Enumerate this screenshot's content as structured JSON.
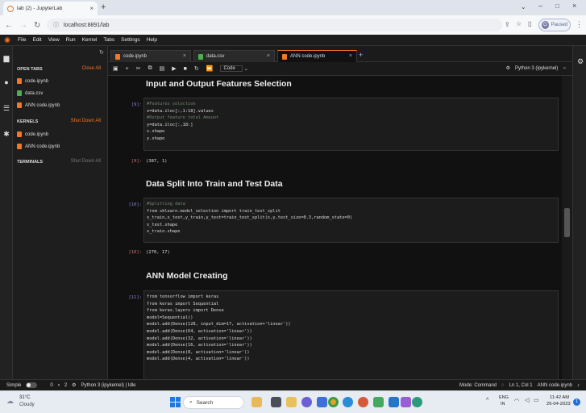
{
  "browser": {
    "tab_title": "lab (2) - JupyterLab",
    "url": "localhost:8891/lab",
    "profile_initial": "G",
    "profile_status": "Paused"
  },
  "menu": [
    "File",
    "Edit",
    "View",
    "Run",
    "Kernel",
    "Tabs",
    "Settings",
    "Help"
  ],
  "sidebar": {
    "open_tabs_title": "OPEN TABS",
    "close_all": "Close All",
    "open_tabs": [
      "code.ipynb",
      "data.csv",
      "ANN code.ipynb"
    ],
    "kernels_title": "KERNELS",
    "shut_down_all": "Shut Down All",
    "kernels": [
      "code.ipynb",
      "ANN code.ipynb"
    ],
    "terminals_title": "TERMINALS",
    "terminals_shut": "Shut Down All"
  },
  "notebook_tabs": [
    {
      "label": "code.ipynb",
      "active": false
    },
    {
      "label": "data.csv",
      "active": false
    },
    {
      "label": "ANN code.ipynb",
      "active": true
    }
  ],
  "toolbar": {
    "cell_type": "Code",
    "kernel": "Python 3 (ipykernel)"
  },
  "cells": {
    "h1": "Input and Output Features Selection",
    "c9_prompt": "[9]:",
    "c9_lines": [
      "#Features selection",
      "x=data.iloc[:,1:18].values",
      "#Output feature total Amount",
      "y=data.iloc[:,18:]",
      "x.shape",
      "y.shape"
    ],
    "o9_prompt": "[9]:",
    "o9_text": "(387, 1)",
    "h2": "Data Split Into Train and Test Data",
    "c10_prompt": "[10]:",
    "c10_lines": [
      "#Splitting data",
      "from sklearn.model_selection import train_test_split",
      "x_train,x_test,y_train,y_test=train_test_split(x,y,test_size=0.3,random_state=0)",
      "x_test.shape",
      "x_train.shape"
    ],
    "o10_prompt": "[10]:",
    "o10_text": "(270, 17)",
    "h3": "ANN Model Creating",
    "c11_prompt": "[11]:",
    "c11_lines": [
      "from tensorflow import keras",
      "from keras import Sequential",
      "from keras.layers import Dense",
      "model=Sequential()",
      "model.add(Dense(128, input_dim=17, activation='linear'))",
      "model.add(Dense(64, activation='linear'))",
      "model.add(Dense(32, activation='linear'))",
      "model.add(Dense(16, activation='linear'))",
      "model.add(Dense(8, activation='linear'))",
      "model.add(Dense(4, activation='linear'))"
    ]
  },
  "status": {
    "mode_label": "Simple",
    "count_a": "0",
    "count_b": "2",
    "kernel_status": "Python 3 (ipykernel) | Idle",
    "mode": "Mode: Command",
    "position": "Ln 1, Col 1",
    "file": "ANN code.ipynb"
  },
  "taskbar": {
    "temp": "31°C",
    "weather": "Cloudy",
    "search": "Search",
    "lang_top": "ENG",
    "lang_bottom": "IN",
    "time": "11:42 AM",
    "date": "26-04-2023",
    "notifications": "1"
  }
}
